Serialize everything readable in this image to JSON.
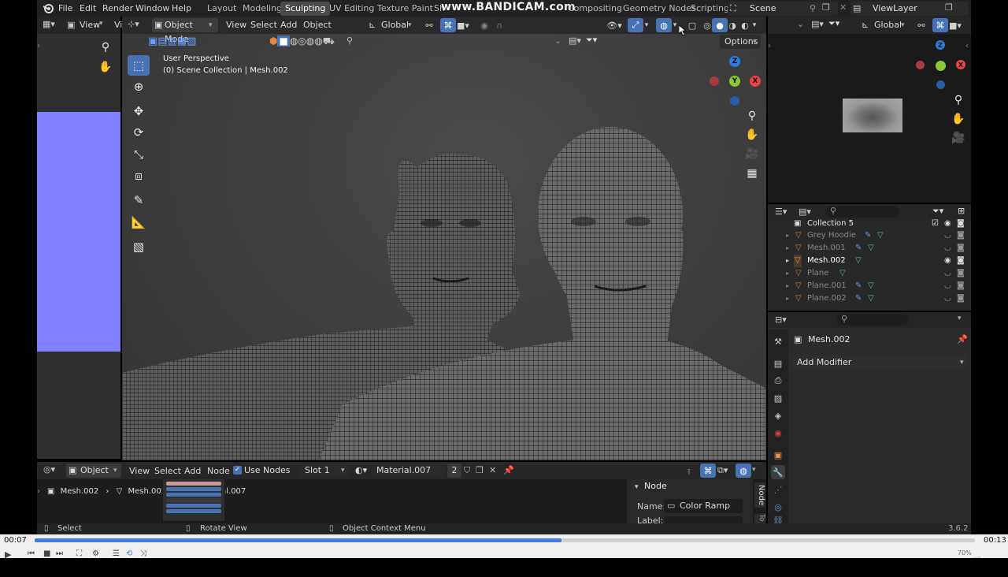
{
  "topbar": {
    "menus": [
      "File",
      "Edit",
      "Render",
      "Window",
      "Help"
    ],
    "workspaces": [
      "Layout",
      "Modeling",
      "Sculpting",
      "UV Editing",
      "Texture Paint",
      "Sh",
      "Compositing",
      "Geometry Nodes",
      "Scripting"
    ],
    "active_workspace": "Sculpting",
    "watermark": "www.BANDICAM.com",
    "scene_name": "Scene",
    "view_layer": "ViewLayer"
  },
  "left_editor": {
    "view_label": "View",
    "truncated_label": "Vi",
    "accent_color": "#8080ff"
  },
  "viewport": {
    "mode": "Object Mode",
    "menus": [
      "View",
      "Select",
      "Add",
      "Object"
    ],
    "transform_orientation": "Global",
    "options_label": "Options",
    "overlay_title": "User Perspective",
    "overlay_subtitle": "(0) Scene Collection | Mesh.002",
    "gizmo_axes": [
      "Z",
      "X",
      "Y"
    ],
    "tools": [
      "select-box",
      "cursor",
      "move",
      "rotate",
      "scale",
      "transform",
      "annotate",
      "measure",
      "add-cube"
    ]
  },
  "right_topbar": {
    "transform_orientation": "Global"
  },
  "outliner": {
    "rows": [
      {
        "name": "Collection 5",
        "type": "collection",
        "dim": false
      },
      {
        "name": "Grey Hoodie",
        "type": "object",
        "dim": true
      },
      {
        "name": "Mesh.001",
        "type": "object",
        "dim": true
      },
      {
        "name": "Mesh.002",
        "type": "object",
        "dim": false
      },
      {
        "name": "Plane",
        "type": "object",
        "dim": true
      },
      {
        "name": "Plane.001",
        "type": "object",
        "dim": true
      },
      {
        "name": "Plane.002",
        "type": "object",
        "dim": true
      }
    ]
  },
  "properties": {
    "object_name": "Mesh.002",
    "add_modifier_label": "Add Modifier"
  },
  "node_editor": {
    "type_label": "Object",
    "menus": [
      "View",
      "Select",
      "Add",
      "Node"
    ],
    "use_nodes_label": "Use Nodes",
    "slot_label": "Slot 1",
    "material_name": "Material.007",
    "user_count": "2",
    "breadcrumb": [
      "Mesh.002",
      "Mesh.005",
      "Material.007"
    ],
    "node_panel_title": "Node",
    "name_label": "Name:",
    "name_value": "Color Ramp",
    "label_label": "Label:",
    "side_tab": "Node",
    "side_tab_2": "To"
  },
  "statusbar": {
    "select_label": "Select",
    "rotate_label": "Rotate View",
    "context_label": "Object Context Menu",
    "version": "3.6.2"
  },
  "player": {
    "current_time": "00:07",
    "total_time": "00:13",
    "progress": 0.56,
    "volume": "70%"
  }
}
